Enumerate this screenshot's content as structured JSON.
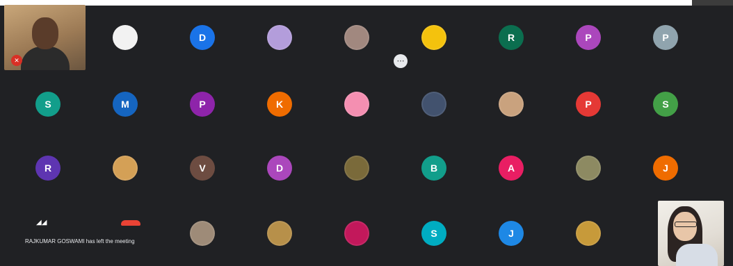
{
  "top_bar": {
    "title_text": ""
  },
  "self_video": {
    "mic_state": "mic-off"
  },
  "participants_row1": [
    {
      "initial": "",
      "color": "#f2f2f2",
      "kind": "photo"
    },
    {
      "initial": "D",
      "color": "#1a73e8",
      "kind": "letter"
    },
    {
      "initial": "",
      "color": "#b39ddb",
      "kind": "photo"
    },
    {
      "initial": "",
      "color": "#a1887f",
      "kind": "photo"
    },
    {
      "initial": "",
      "color": "#f4c20d",
      "kind": "photo"
    },
    {
      "initial": "R",
      "color": "#0b6e4f",
      "kind": "letter"
    },
    {
      "initial": "P",
      "color": "#ab47bc",
      "kind": "letter"
    },
    {
      "initial": "P",
      "color": "#90a4ae",
      "kind": "letter"
    }
  ],
  "participants_row2": [
    {
      "initial": "S",
      "color": "#129e8b",
      "kind": "letter"
    },
    {
      "initial": "M",
      "color": "#1565c0",
      "kind": "letter"
    },
    {
      "initial": "P",
      "color": "#8e24aa",
      "kind": "letter"
    },
    {
      "initial": "K",
      "color": "#ef6c00",
      "kind": "letter"
    },
    {
      "initial": "",
      "color": "#f48fb1",
      "kind": "photo"
    },
    {
      "initial": "",
      "color": "#42526e",
      "kind": "photo"
    },
    {
      "initial": "",
      "color": "#c9a27e",
      "kind": "photo"
    },
    {
      "initial": "P",
      "color": "#e53935",
      "kind": "letter"
    },
    {
      "initial": "S",
      "color": "#43a047",
      "kind": "letter"
    }
  ],
  "participants_row3": [
    {
      "initial": "R",
      "color": "#5e35b1",
      "kind": "letter"
    },
    {
      "initial": "",
      "color": "#d4a056",
      "kind": "photo"
    },
    {
      "initial": "V",
      "color": "#6d4c41",
      "kind": "letter"
    },
    {
      "initial": "D",
      "color": "#ab47bc",
      "kind": "letter"
    },
    {
      "initial": "",
      "color": "#7a6a3a",
      "kind": "photo"
    },
    {
      "initial": "B",
      "color": "#129e8b",
      "kind": "letter"
    },
    {
      "initial": "A",
      "color": "#e91e63",
      "kind": "letter"
    },
    {
      "initial": "",
      "color": "#8d8a62",
      "kind": "photo"
    },
    {
      "initial": "J",
      "color": "#ef6c00",
      "kind": "letter"
    }
  ],
  "participants_row4": [
    {
      "initial": "",
      "color": "#9e8b78",
      "kind": "photo"
    },
    {
      "initial": "",
      "color": "#b7904a",
      "kind": "photo"
    },
    {
      "initial": "",
      "color": "#c2185b",
      "kind": "photo"
    },
    {
      "initial": "S",
      "color": "#00acc1",
      "kind": "letter"
    },
    {
      "initial": "J",
      "color": "#1e88e5",
      "kind": "letter"
    },
    {
      "initial": "",
      "color": "#c79a3a",
      "kind": "photo"
    }
  ],
  "mini_badge": {
    "icon": "more-options-icon"
  },
  "status": {
    "message": "RAJKUMAR GOSWAMI has left the meeting"
  }
}
